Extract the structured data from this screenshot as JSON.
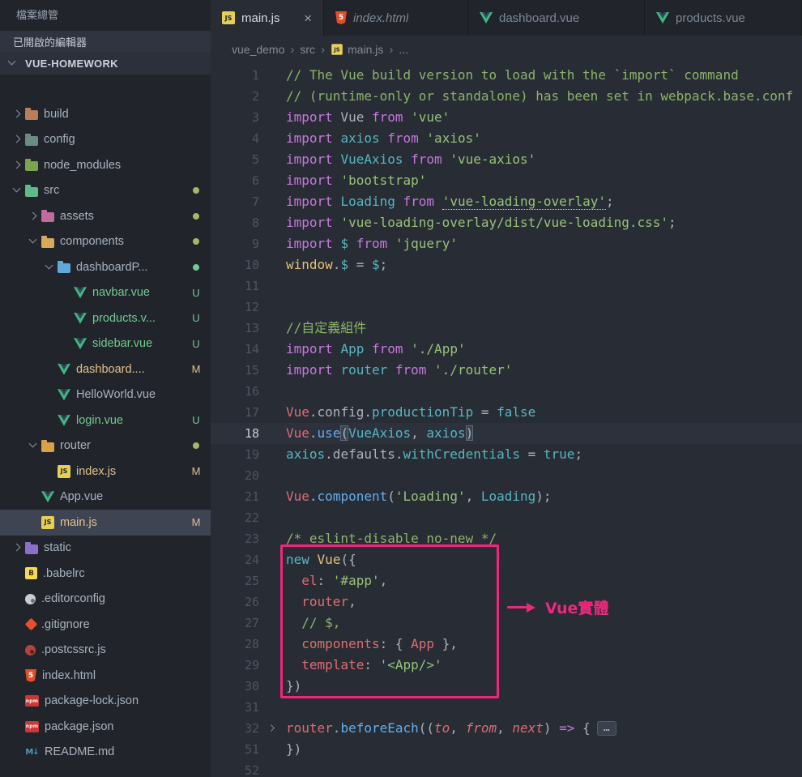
{
  "colors": {
    "accent_pink": "#f1267d",
    "badge_untracked": "#73c991",
    "badge_modified": "#e2c08d"
  },
  "sidebar": {
    "title": "檔案總管",
    "open_editors_label": "已開啟的編輯器",
    "workspace_label": "VUE-HOMEWORK",
    "tree": [
      {
        "label": "build",
        "type": "folder",
        "indent": 0,
        "expanded": false,
        "iconColor": "#b97c5c"
      },
      {
        "label": "config",
        "type": "folder",
        "indent": 0,
        "expanded": false,
        "iconColor": "#6d8a83"
      },
      {
        "label": "node_modules",
        "type": "folder",
        "indent": 0,
        "expanded": false,
        "iconColor": "#7aa352"
      },
      {
        "label": "src",
        "type": "folder",
        "indent": 0,
        "expanded": true,
        "iconColor": "#5fb98c",
        "badge": "dot",
        "badgeColor": "#a9b665"
      },
      {
        "label": "assets",
        "type": "folder",
        "indent": 1,
        "expanded": false,
        "iconColor": "#bf6b9d",
        "badge": "dot",
        "badgeColor": "#a9b665"
      },
      {
        "label": "components",
        "type": "folder",
        "indent": 1,
        "expanded": true,
        "iconColor": "#d9a959",
        "badge": "dot",
        "badgeColor": "#a9b665"
      },
      {
        "label": "dashboardP...",
        "type": "folder",
        "indent": 2,
        "expanded": true,
        "iconColor": "#5fa8d7",
        "badge": "dot",
        "badgeColor": "#73c991"
      },
      {
        "label": "navbar.vue",
        "type": "file",
        "icon": "vue",
        "indent": 3,
        "badge": "U",
        "status": "untracked"
      },
      {
        "label": "products.v...",
        "type": "file",
        "icon": "vue",
        "indent": 3,
        "badge": "U",
        "status": "untracked"
      },
      {
        "label": "sidebar.vue",
        "type": "file",
        "icon": "vue",
        "indent": 3,
        "badge": "U",
        "status": "untracked"
      },
      {
        "label": "dashboard....",
        "type": "file",
        "icon": "vue",
        "indent": 2,
        "badge": "M",
        "status": "modified"
      },
      {
        "label": "HelloWorld.vue",
        "type": "file",
        "icon": "vue",
        "indent": 2
      },
      {
        "label": "login.vue",
        "type": "file",
        "icon": "vue",
        "indent": 2,
        "badge": "U",
        "status": "untracked"
      },
      {
        "label": "router",
        "type": "folder",
        "indent": 1,
        "expanded": true,
        "iconColor": "#d9a24a",
        "badge": "dot",
        "badgeColor": "#a9b665"
      },
      {
        "label": "index.js",
        "type": "file",
        "icon": "js",
        "indent": 2,
        "badge": "M",
        "status": "modified"
      },
      {
        "label": "App.vue",
        "type": "file",
        "icon": "vue",
        "indent": 1
      },
      {
        "label": "main.js",
        "type": "file",
        "icon": "js",
        "indent": 1,
        "badge": "M",
        "status": "modified",
        "selected": true
      },
      {
        "label": "static",
        "type": "folder",
        "indent": 0,
        "expanded": false,
        "iconColor": "#8a70c9"
      },
      {
        "label": ".babelrc",
        "type": "file",
        "icon": "babel",
        "indent": 0
      },
      {
        "label": ".editorconfig",
        "type": "file",
        "icon": "editorconfig",
        "indent": 0
      },
      {
        "label": ".gitignore",
        "type": "file",
        "icon": "git",
        "indent": 0
      },
      {
        "label": ".postcssrc.js",
        "type": "file",
        "icon": "postcss",
        "indent": 0
      },
      {
        "label": "index.html",
        "type": "file",
        "icon": "html",
        "indent": 0
      },
      {
        "label": "package-lock.json",
        "type": "file",
        "icon": "npm",
        "indent": 0
      },
      {
        "label": "package.json",
        "type": "file",
        "icon": "npm",
        "indent": 0
      },
      {
        "label": "README.md",
        "type": "file",
        "icon": "md",
        "indent": 0
      }
    ]
  },
  "tabs": [
    {
      "label": "main.js",
      "icon": "js",
      "active": true,
      "close": "×"
    },
    {
      "label": "index.html",
      "icon": "html",
      "preview": true
    },
    {
      "label": "dashboard.vue",
      "icon": "vue"
    },
    {
      "label": "products.vue",
      "icon": "vue"
    }
  ],
  "breadcrumb": {
    "separator": "›",
    "items": [
      {
        "label": "vue_demo"
      },
      {
        "label": "src"
      },
      {
        "label": "main.js",
        "icon": "js"
      },
      {
        "label": "..."
      }
    ]
  },
  "editor": {
    "fold_ellipsis": "…",
    "lines": [
      {
        "n": 1,
        "segs": [
          [
            "cm",
            "// The Vue build version to load with the `import` command"
          ]
        ]
      },
      {
        "n": 2,
        "segs": [
          [
            "cm",
            "// (runtime-only or standalone) has been set in webpack.base.conf"
          ]
        ]
      },
      {
        "n": 3,
        "segs": [
          [
            "kw",
            "import"
          ],
          [
            "df",
            " Vue "
          ],
          [
            "kw",
            "from"
          ],
          [
            "df",
            " "
          ],
          [
            "st",
            "'vue'"
          ]
        ]
      },
      {
        "n": 4,
        "segs": [
          [
            "kw",
            "import"
          ],
          [
            "df",
            " "
          ],
          [
            "cy",
            "axios"
          ],
          [
            "df",
            " "
          ],
          [
            "kw",
            "from"
          ],
          [
            "df",
            " "
          ],
          [
            "st",
            "'axios'"
          ]
        ]
      },
      {
        "n": 5,
        "segs": [
          [
            "kw",
            "import"
          ],
          [
            "df",
            " "
          ],
          [
            "cy",
            "VueAxios"
          ],
          [
            "df",
            " "
          ],
          [
            "kw",
            "from"
          ],
          [
            "df",
            " "
          ],
          [
            "st",
            "'vue-axios'"
          ]
        ]
      },
      {
        "n": 6,
        "segs": [
          [
            "kw",
            "import"
          ],
          [
            "df",
            " "
          ],
          [
            "st",
            "'bootstrap'"
          ]
        ]
      },
      {
        "n": 7,
        "segs": [
          [
            "kw",
            "import"
          ],
          [
            "df",
            " "
          ],
          [
            "cy",
            "Loading"
          ],
          [
            "df",
            " "
          ],
          [
            "kw",
            "from"
          ],
          [
            "df",
            " "
          ],
          [
            "stu",
            "'vue-loading-overlay'"
          ],
          [
            "df",
            ";"
          ]
        ]
      },
      {
        "n": 8,
        "segs": [
          [
            "kw",
            "import"
          ],
          [
            "df",
            " "
          ],
          [
            "st",
            "'vue-loading-overlay/dist/vue-loading.css'"
          ],
          [
            "df",
            ";"
          ]
        ]
      },
      {
        "n": 9,
        "segs": [
          [
            "kw",
            "import"
          ],
          [
            "df",
            " "
          ],
          [
            "cy",
            "$"
          ],
          [
            "df",
            " "
          ],
          [
            "kw",
            "from"
          ],
          [
            "df",
            " "
          ],
          [
            "st",
            "'jquery'"
          ]
        ]
      },
      {
        "n": 10,
        "segs": [
          [
            "yl",
            "window"
          ],
          [
            "df",
            "."
          ],
          [
            "cy",
            "$"
          ],
          [
            "df",
            " = "
          ],
          [
            "cy",
            "$"
          ],
          [
            "df",
            ";"
          ]
        ]
      },
      {
        "n": 11,
        "segs": []
      },
      {
        "n": 12,
        "segs": []
      },
      {
        "n": 13,
        "segs": [
          [
            "cm",
            "//自定義組件"
          ]
        ]
      },
      {
        "n": 14,
        "segs": [
          [
            "kw",
            "import"
          ],
          [
            "df",
            " "
          ],
          [
            "cy",
            "App"
          ],
          [
            "df",
            " "
          ],
          [
            "kw",
            "from"
          ],
          [
            "df",
            " "
          ],
          [
            "st",
            "'./App'"
          ]
        ]
      },
      {
        "n": 15,
        "segs": [
          [
            "kw",
            "import"
          ],
          [
            "df",
            " "
          ],
          [
            "cy",
            "router"
          ],
          [
            "df",
            " "
          ],
          [
            "kw",
            "from"
          ],
          [
            "df",
            " "
          ],
          [
            "st",
            "'./router'"
          ]
        ]
      },
      {
        "n": 16,
        "segs": []
      },
      {
        "n": 17,
        "segs": [
          [
            "rd",
            "Vue"
          ],
          [
            "df",
            ".config."
          ],
          [
            "cy",
            "productionTip"
          ],
          [
            "df",
            " = "
          ],
          [
            "cb",
            "false"
          ]
        ]
      },
      {
        "n": 18,
        "current": true,
        "segs": [
          [
            "rd",
            "Vue"
          ],
          [
            "df",
            "."
          ],
          [
            "fn",
            "use"
          ],
          [
            "br",
            "("
          ],
          [
            "cy",
            "VueAxios"
          ],
          [
            "df",
            ", "
          ],
          [
            "cy",
            "axios"
          ],
          [
            "br",
            ")"
          ]
        ]
      },
      {
        "n": 19,
        "segs": [
          [
            "cy",
            "axios"
          ],
          [
            "df",
            ".defaults."
          ],
          [
            "cy",
            "withCredentials"
          ],
          [
            "df",
            " = "
          ],
          [
            "cb",
            "true"
          ],
          [
            "df",
            ";"
          ]
        ]
      },
      {
        "n": 20,
        "segs": []
      },
      {
        "n": 21,
        "segs": [
          [
            "rd",
            "Vue"
          ],
          [
            "df",
            "."
          ],
          [
            "fn",
            "component"
          ],
          [
            "df",
            "("
          ],
          [
            "st",
            "'Loading'"
          ],
          [
            "df",
            ", "
          ],
          [
            "cy",
            "Loading"
          ],
          [
            "df",
            ");"
          ]
        ]
      },
      {
        "n": 22,
        "segs": []
      },
      {
        "n": 23,
        "segs": [
          [
            "cm",
            "/* eslint-disable no-new */"
          ]
        ]
      },
      {
        "n": 24,
        "segs": [
          [
            "cy",
            "new"
          ],
          [
            "df",
            " "
          ],
          [
            "yl",
            "Vue"
          ],
          [
            "df",
            "({"
          ]
        ]
      },
      {
        "n": 25,
        "segs": [
          [
            "df",
            "  "
          ],
          [
            "rd",
            "el"
          ],
          [
            "df",
            ": "
          ],
          [
            "st",
            "'#app'"
          ],
          [
            "df",
            ","
          ]
        ]
      },
      {
        "n": 26,
        "segs": [
          [
            "df",
            "  "
          ],
          [
            "rd",
            "router"
          ],
          [
            "df",
            ","
          ]
        ]
      },
      {
        "n": 27,
        "segs": [
          [
            "cm",
            "  // $,"
          ]
        ]
      },
      {
        "n": 28,
        "segs": [
          [
            "df",
            "  "
          ],
          [
            "rd",
            "components"
          ],
          [
            "df",
            ": { "
          ],
          [
            "rd",
            "App"
          ],
          [
            "df",
            " },"
          ]
        ]
      },
      {
        "n": 29,
        "segs": [
          [
            "df",
            "  "
          ],
          [
            "rd",
            "template"
          ],
          [
            "df",
            ": "
          ],
          [
            "st",
            "'<App/>'"
          ]
        ]
      },
      {
        "n": 30,
        "segs": [
          [
            "df",
            "})"
          ]
        ]
      },
      {
        "n": 31,
        "segs": []
      },
      {
        "n": 32,
        "fold": true,
        "ellipsis": true,
        "segs": [
          [
            "rd",
            "router"
          ],
          [
            "df",
            "."
          ],
          [
            "fn",
            "beforeEach"
          ],
          [
            "df",
            "(("
          ],
          [
            "pm",
            "to"
          ],
          [
            "df",
            ", "
          ],
          [
            "pm",
            "from"
          ],
          [
            "df",
            ", "
          ],
          [
            "pm",
            "next"
          ],
          [
            "df",
            ") "
          ],
          [
            "pr",
            "=>"
          ],
          [
            "df",
            " {"
          ]
        ]
      },
      {
        "n": 51,
        "segs": [
          [
            "df",
            "})"
          ]
        ]
      },
      {
        "n": 52,
        "segs": []
      }
    ]
  },
  "annotation": {
    "label": "Vue實體"
  }
}
